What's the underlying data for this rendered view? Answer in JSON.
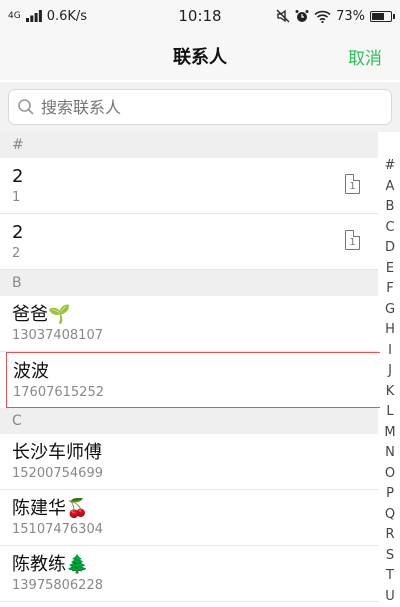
{
  "status_bar": {
    "network": "4G",
    "speed": "0.6K/s",
    "time": "10:18",
    "battery": "73%",
    "battery_level": 0.73
  },
  "nav": {
    "title": "联系人",
    "cancel": "取消"
  },
  "search": {
    "placeholder": "搜索联系人"
  },
  "sections": [
    {
      "header": "#",
      "contacts": [
        {
          "name": "2",
          "sub": "1",
          "sim": "1"
        },
        {
          "name": "2",
          "sub": "2",
          "sim": "1"
        }
      ]
    },
    {
      "header": "B",
      "contacts": [
        {
          "name": "爸爸🌱",
          "sub": "13037408107"
        },
        {
          "name": "波波",
          "sub": "17607615252",
          "highlighted": true
        }
      ]
    },
    {
      "header": "C",
      "contacts": [
        {
          "name": "长沙车师傅",
          "sub": "15200754699"
        },
        {
          "name": "陈建华🍒",
          "sub": "15107476304"
        },
        {
          "name": "陈教练🌲",
          "sub": "13975806228"
        }
      ]
    }
  ],
  "index": [
    "#",
    "A",
    "B",
    "C",
    "D",
    "E",
    "F",
    "G",
    "H",
    "I",
    "J",
    "K",
    "L",
    "M",
    "N",
    "O",
    "P",
    "Q",
    "R",
    "S",
    "T",
    "U"
  ],
  "colors": {
    "accent": "#2dbe5c",
    "highlight_border": "#e05555"
  }
}
